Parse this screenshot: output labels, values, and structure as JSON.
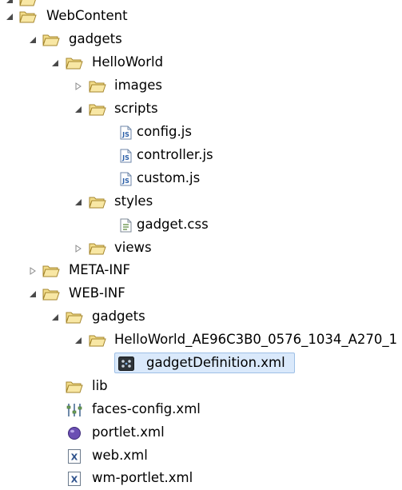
{
  "explorer": {
    "items": [
      {
        "label": "",
        "twisty": "expanded",
        "icon": "folder-open-icon"
      },
      {
        "label": "WebContent",
        "twisty": "expanded",
        "icon": "folder-open-icon"
      },
      {
        "label": "gadgets",
        "twisty": "expanded",
        "icon": "folder-open-icon"
      },
      {
        "label": "HelloWorld",
        "twisty": "expanded",
        "icon": "folder-open-icon"
      },
      {
        "label": "images",
        "twisty": "collapsed",
        "icon": "folder-icon"
      },
      {
        "label": "scripts",
        "twisty": "expanded",
        "icon": "folder-open-icon"
      },
      {
        "label": "config.js",
        "twisty": "none",
        "icon": "js-file-icon"
      },
      {
        "label": "controller.js",
        "twisty": "none",
        "icon": "js-file-icon"
      },
      {
        "label": "custom.js",
        "twisty": "none",
        "icon": "js-file-icon"
      },
      {
        "label": "styles",
        "twisty": "expanded",
        "icon": "folder-open-icon"
      },
      {
        "label": "gadget.css",
        "twisty": "none",
        "icon": "css-file-icon"
      },
      {
        "label": "views",
        "twisty": "collapsed",
        "icon": "folder-icon"
      },
      {
        "label": "META-INF",
        "twisty": "collapsed",
        "icon": "folder-icon"
      },
      {
        "label": "WEB-INF",
        "twisty": "expanded",
        "icon": "folder-open-icon"
      },
      {
        "label": "gadgets",
        "twisty": "expanded",
        "icon": "folder-open-icon"
      },
      {
        "label": "HelloWorld_AE96C3B0_0576_1034_A270_1",
        "twisty": "expanded",
        "icon": "folder-open-icon"
      },
      {
        "label": "gadgetDefinition.xml",
        "twisty": "none",
        "icon": "gadget-xml-icon",
        "selected": true
      },
      {
        "label": "lib",
        "twisty": "none",
        "icon": "folder-icon"
      },
      {
        "label": "faces-config.xml",
        "twisty": "none",
        "icon": "faces-config-icon"
      },
      {
        "label": "portlet.xml",
        "twisty": "none",
        "icon": "portlet-icon"
      },
      {
        "label": "web.xml",
        "twisty": "none",
        "icon": "xml-file-icon"
      },
      {
        "label": "wm-portlet.xml",
        "twisty": "none",
        "icon": "xml-file-icon"
      }
    ]
  }
}
